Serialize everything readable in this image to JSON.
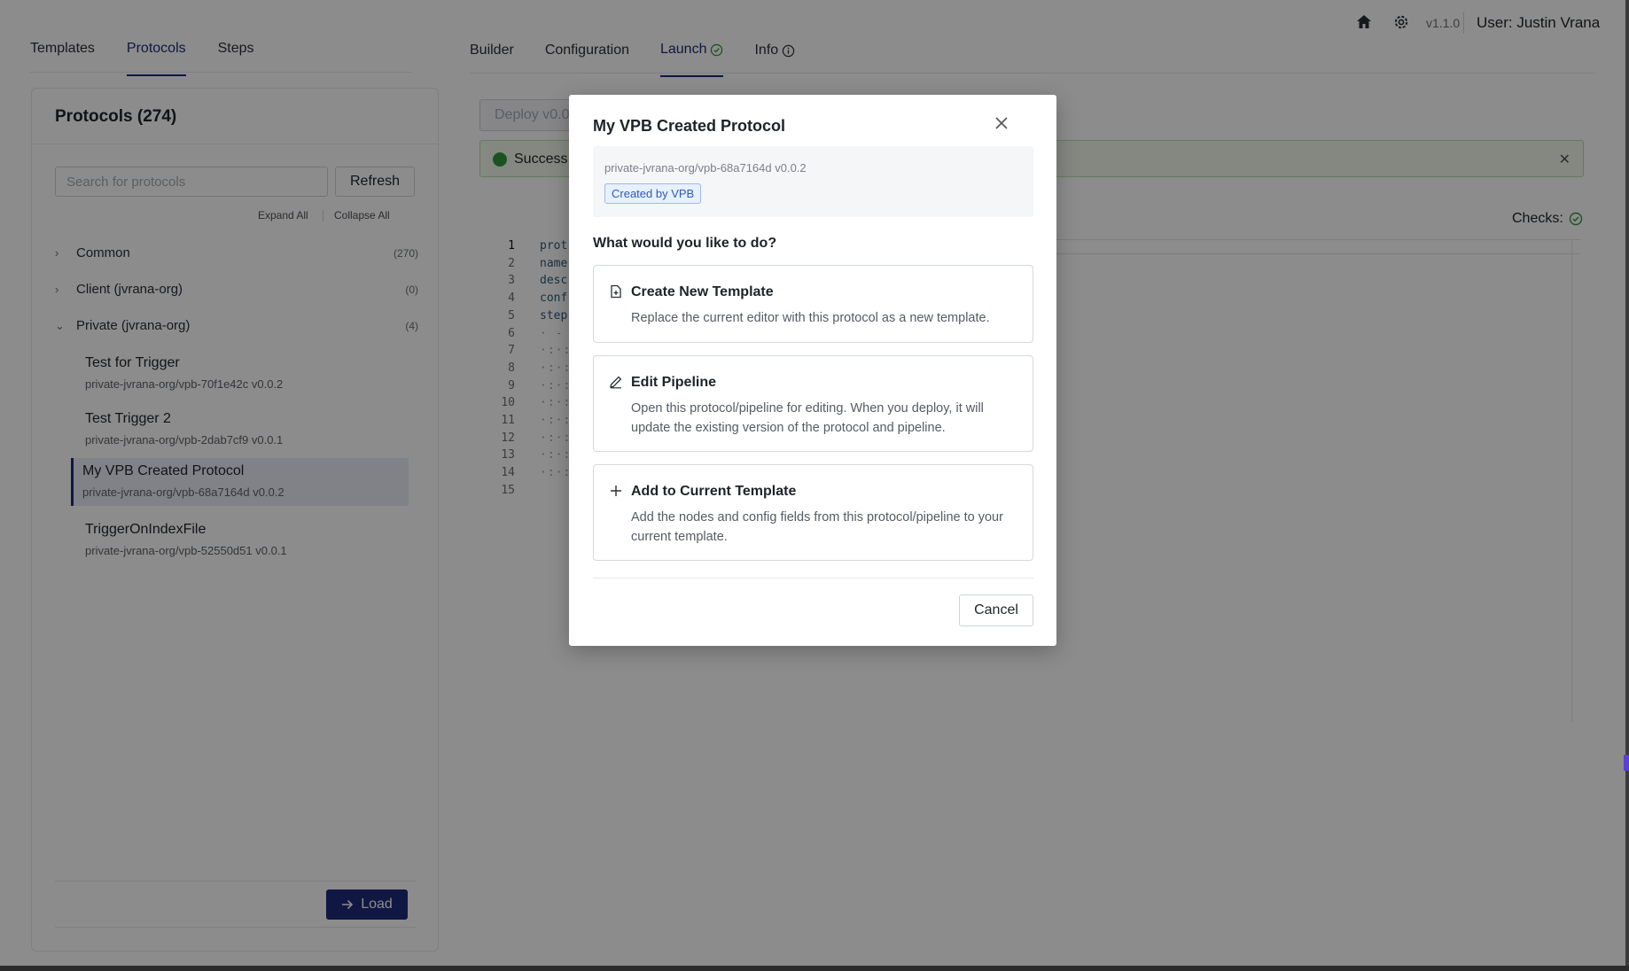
{
  "topbar": {
    "version": "v1.1.0",
    "user": "User: Justin Vrana",
    "icons": [
      "home-icon",
      "gear-icon"
    ]
  },
  "left_tabs": [
    {
      "label": "Templates",
      "active": false
    },
    {
      "label": "Protocols",
      "active": true
    },
    {
      "label": "Steps",
      "active": false
    }
  ],
  "protocols_panel": {
    "title": "Protocols (274)",
    "search_placeholder": "Search for protocols",
    "refresh_label": "Refresh",
    "expand_all": "Expand All",
    "collapse_all": "Collapse All",
    "groups": [
      {
        "label": "Common",
        "count": "(270)",
        "expanded": false
      },
      {
        "label": "Client (jvrana-org)",
        "count": "(0)",
        "expanded": false
      },
      {
        "label": "Private (jvrana-org)",
        "count": "(4)",
        "expanded": true
      }
    ],
    "items": [
      {
        "name": "Test for Trigger",
        "sub": "private-jvrana-org/vpb-70f1e42c v0.0.2"
      },
      {
        "name": "Test Trigger 2",
        "sub": "private-jvrana-org/vpb-2dab7cf9 v0.0.1"
      },
      {
        "name": "My VPB Created Protocol",
        "sub": "private-jvrana-org/vpb-68a7164d v0.0.2",
        "selected": true
      },
      {
        "name": "TriggerOnIndexFile",
        "sub": "private-jvrana-org/vpb-52550d51 v0.0.1"
      }
    ],
    "load_label": "Load"
  },
  "right_tabs": [
    {
      "label": "Builder",
      "active": false
    },
    {
      "label": "Configuration",
      "active": false
    },
    {
      "label": "Launch",
      "active": true
    },
    {
      "label": "Info",
      "active": false
    }
  ],
  "launch": {
    "deploy_label": "Deploy v0.0",
    "success_text": "Success!",
    "checks_label": "Checks:",
    "code_lines": [
      {
        "n": "1",
        "t": "prot"
      },
      {
        "n": "2",
        "t": "name"
      },
      {
        "n": "3",
        "t": "desc"
      },
      {
        "n": "4",
        "t": "conf"
      },
      {
        "n": "5",
        "t": "step"
      },
      {
        "n": "6",
        "t": "· -"
      },
      {
        "n": "7",
        "t": "·:·:"
      },
      {
        "n": "8",
        "t": "·:·:"
      },
      {
        "n": "9",
        "t": "·:·:"
      },
      {
        "n": "10",
        "t": "·:·:"
      },
      {
        "n": "11",
        "t": "·:·:"
      },
      {
        "n": "12",
        "t": "·:·:"
      },
      {
        "n": "13",
        "t": "·:·:"
      },
      {
        "n": "14",
        "t": "·:·:"
      },
      {
        "n": "15",
        "t": ""
      }
    ]
  },
  "modal": {
    "title": "My VPB Created Protocol",
    "path": "private-jvrana-org/vpb-68a7164d v0.0.2",
    "badge": "Created by VPB",
    "question": "What would you like to do?",
    "options": [
      {
        "icon": "file-plus-icon",
        "title": "Create New Template",
        "desc": "Replace the current editor with this protocol as a new template."
      },
      {
        "icon": "pencil-icon",
        "title": "Edit Pipeline",
        "desc": "Open this protocol/pipeline for editing. When you deploy, it will update the existing version of the protocol and pipeline."
      },
      {
        "icon": "plus-icon",
        "title": "Add to Current Template",
        "desc": "Add the nodes and config fields from this protocol/pipeline to your current template."
      }
    ],
    "cancel_label": "Cancel"
  },
  "colors": {
    "accent": "#1e2a78",
    "success": "#2f9a3b",
    "badge": "#2a5bb8"
  }
}
